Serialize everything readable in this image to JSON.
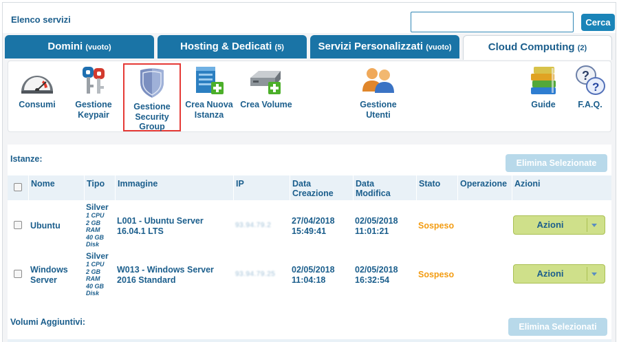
{
  "topbar": {
    "title": "Elenco servizi",
    "search_value": "",
    "search_button": "Cerca"
  },
  "tabs": [
    {
      "label": "Domini",
      "count": "(vuoto)"
    },
    {
      "label": "Hosting & Dedicati",
      "count": "(5)"
    },
    {
      "label": "Servizi Personalizzati",
      "count": "(vuoto)"
    },
    {
      "label": "Cloud Computing",
      "count": "(2)"
    }
  ],
  "tools": {
    "consumi": "Consumi",
    "keypair_1": "Gestione",
    "keypair_2": "Keypair",
    "security_1": "Gestione",
    "security_2": "Security",
    "security_3": "Group",
    "istanza_1": "Crea Nuova",
    "istanza_2": "Istanza",
    "volume": "Crea Volume",
    "utenti_1": "Gestione",
    "utenti_2": "Utenti",
    "guide": "Guide",
    "faq": "F.A.Q."
  },
  "instances": {
    "label": "Istanze:",
    "delete_button": "Elimina Selezionate",
    "columns": {
      "nome": "Nome",
      "tipo": "Tipo",
      "immagine": "Immagine",
      "ip": "IP",
      "creazione_1": "Data",
      "creazione_2": "Creazione",
      "modifica_1": "Data",
      "modifica_2": "Modifica",
      "stato": "Stato",
      "operazione": "Operazione",
      "azioni": "Azioni"
    },
    "rows": [
      {
        "nome_1": "Ubuntu",
        "nome_2": "",
        "tipo": "Silver",
        "spec_1": "1 CPU",
        "spec_2": "2 GB",
        "spec_3": "RAM",
        "spec_4": "40 GB",
        "spec_5": "Disk",
        "immagine_1": "L001 - Ubuntu Server",
        "immagine_2": "16.04.1 LTS",
        "ip": "93.94.79.2",
        "creazione_1": "27/04/2018",
        "creazione_2": "15:49:41",
        "modifica_1": "02/05/2018",
        "modifica_2": "11:01:21",
        "stato": "Sospeso",
        "azioni": "Azioni"
      },
      {
        "nome_1": "Windows",
        "nome_2": "Server",
        "tipo": "Silver",
        "spec_1": "1 CPU",
        "spec_2": "2 GB",
        "spec_3": "RAM",
        "spec_4": "40 GB",
        "spec_5": "Disk",
        "immagine_1": "W013 - Windows Server",
        "immagine_2": "2016 Standard",
        "ip": "93.94.79.25",
        "creazione_1": "02/05/2018",
        "creazione_2": "11:04:18",
        "modifica_1": "02/05/2018",
        "modifica_2": "16:32:54",
        "stato": "Sospeso",
        "azioni": "Azioni"
      }
    ]
  },
  "volumes": {
    "label": "Volumi Aggiuntivi:",
    "delete_button": "Elimina Selezionati"
  },
  "colors": {
    "tab_blue": "#1a74a6",
    "text_blue": "#1b5e8c",
    "status_orange": "#f39c12",
    "action_green": "#cfe08a",
    "highlight_red": "#e53935"
  }
}
